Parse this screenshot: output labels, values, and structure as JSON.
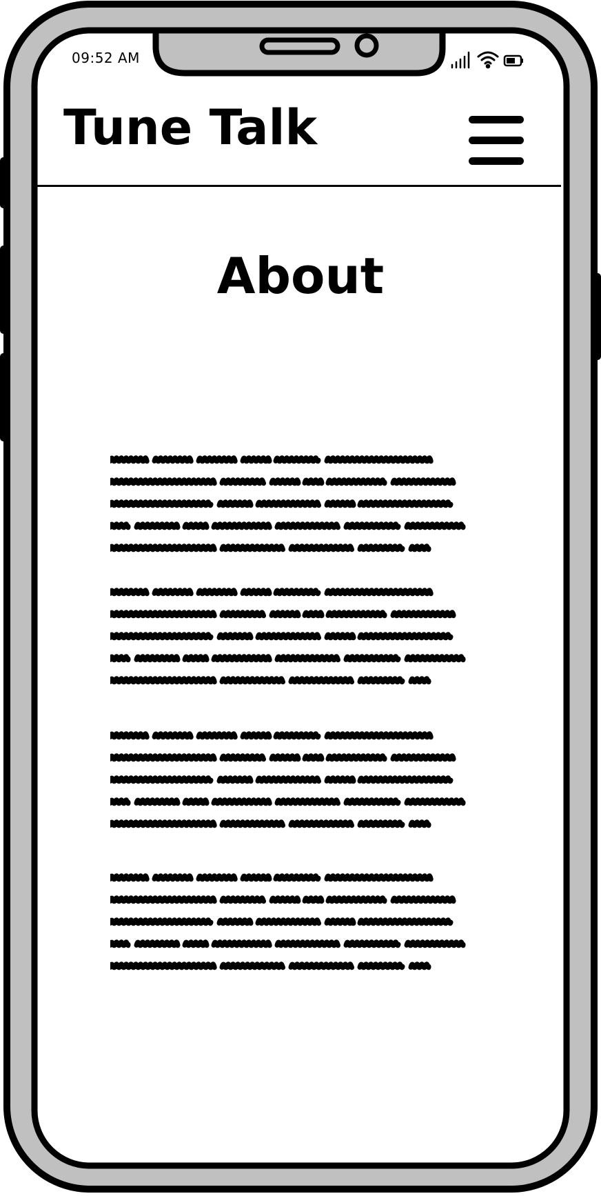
{
  "status_bar": {
    "time": "09:52 AM",
    "icons": [
      "signal-icon",
      "wifi-icon",
      "battery-icon"
    ]
  },
  "header": {
    "title": "Tune Talk",
    "menu_icon": "hamburger-menu-icon"
  },
  "main": {
    "heading": "About",
    "paragraphs": [
      {
        "kind": "placeholder-scribble-text",
        "lines": 5
      },
      {
        "kind": "placeholder-scribble-text",
        "lines": 5
      },
      {
        "kind": "placeholder-scribble-text",
        "lines": 5
      },
      {
        "kind": "placeholder-scribble-text",
        "lines": 5
      }
    ]
  },
  "colors": {
    "ink": "#000000",
    "bezel": "#c0c0c0",
    "screen": "#ffffff"
  }
}
